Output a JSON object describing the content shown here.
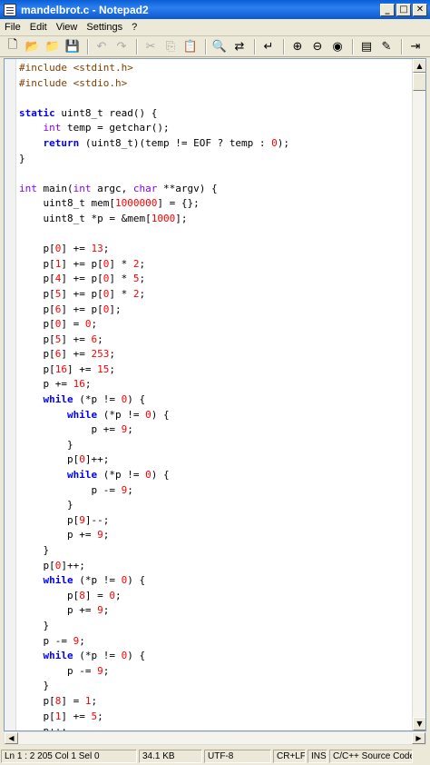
{
  "window": {
    "title": "mandelbrot.c - Notepad2"
  },
  "menu": [
    "File",
    "Edit",
    "View",
    "Settings",
    "?"
  ],
  "toolbar": [
    {
      "icon": "new-file-icon",
      "glyph": "🗋",
      "enabled": true
    },
    {
      "icon": "open-folder-icon",
      "glyph": "📂",
      "enabled": true
    },
    {
      "icon": "browse-icon",
      "glyph": "📁",
      "enabled": true
    },
    {
      "icon": "save-icon",
      "glyph": "💾",
      "enabled": true
    },
    {
      "sep": true
    },
    {
      "icon": "undo-icon",
      "glyph": "↶",
      "enabled": false
    },
    {
      "icon": "redo-icon",
      "glyph": "↷",
      "enabled": false
    },
    {
      "sep": true
    },
    {
      "icon": "cut-icon",
      "glyph": "✂",
      "enabled": false
    },
    {
      "icon": "copy-icon",
      "glyph": "⎘",
      "enabled": false
    },
    {
      "icon": "paste-icon",
      "glyph": "📋",
      "enabled": false
    },
    {
      "sep": true
    },
    {
      "icon": "find-icon",
      "glyph": "🔍",
      "enabled": true
    },
    {
      "icon": "replace-icon",
      "glyph": "⇄",
      "enabled": true
    },
    {
      "sep": true
    },
    {
      "icon": "word-wrap-icon",
      "glyph": "↵",
      "enabled": true
    },
    {
      "sep": true
    },
    {
      "icon": "zoom-in-icon",
      "glyph": "⊕",
      "enabled": true
    },
    {
      "icon": "zoom-out-icon",
      "glyph": "⊖",
      "enabled": true
    },
    {
      "icon": "scheme-icon",
      "glyph": "◉",
      "enabled": true
    },
    {
      "sep": true
    },
    {
      "icon": "settings-icon",
      "glyph": "▤",
      "enabled": true
    },
    {
      "icon": "customize-icon",
      "glyph": "✎",
      "enabled": true
    },
    {
      "sep": true
    },
    {
      "icon": "exit-icon",
      "glyph": "⇥",
      "enabled": true
    }
  ],
  "code_lines": [
    [
      [
        "pp",
        "#include "
      ],
      [
        "inc",
        "<stdint.h>"
      ]
    ],
    [
      [
        "pp",
        "#include "
      ],
      [
        "inc",
        "<stdio.h>"
      ]
    ],
    [],
    [
      [
        "kw",
        "static "
      ],
      [
        "t",
        "uint8_t read() {"
      ]
    ],
    [
      [
        "t",
        "    "
      ],
      [
        "ty",
        "int"
      ],
      [
        "t",
        " temp = getchar();"
      ]
    ],
    [
      [
        "t",
        "    "
      ],
      [
        "kw",
        "return"
      ],
      [
        "t",
        " (uint8_t)(temp != EOF ? temp : "
      ],
      [
        "num",
        "0"
      ],
      [
        "t",
        ");"
      ]
    ],
    [
      [
        "t",
        "}"
      ]
    ],
    [],
    [
      [
        "ty",
        "int"
      ],
      [
        "t",
        " main("
      ],
      [
        "ty",
        "int"
      ],
      [
        "t",
        " argc, "
      ],
      [
        "ty",
        "char"
      ],
      [
        "t",
        " **argv) {"
      ]
    ],
    [
      [
        "t",
        "    uint8_t mem["
      ],
      [
        "num",
        "1000000"
      ],
      [
        "t",
        "] = {};"
      ]
    ],
    [
      [
        "t",
        "    uint8_t *p = &mem["
      ],
      [
        "num",
        "1000"
      ],
      [
        "t",
        "];"
      ]
    ],
    [],
    [
      [
        "t",
        "    p["
      ],
      [
        "num",
        "0"
      ],
      [
        "t",
        "] += "
      ],
      [
        "num",
        "13"
      ],
      [
        "t",
        ";"
      ]
    ],
    [
      [
        "t",
        "    p["
      ],
      [
        "num",
        "1"
      ],
      [
        "t",
        "] += p["
      ],
      [
        "num",
        "0"
      ],
      [
        "t",
        "] * "
      ],
      [
        "num",
        "2"
      ],
      [
        "t",
        ";"
      ]
    ],
    [
      [
        "t",
        "    p["
      ],
      [
        "num",
        "4"
      ],
      [
        "t",
        "] += p["
      ],
      [
        "num",
        "0"
      ],
      [
        "t",
        "] * "
      ],
      [
        "num",
        "5"
      ],
      [
        "t",
        ";"
      ]
    ],
    [
      [
        "t",
        "    p["
      ],
      [
        "num",
        "5"
      ],
      [
        "t",
        "] += p["
      ],
      [
        "num",
        "0"
      ],
      [
        "t",
        "] * "
      ],
      [
        "num",
        "2"
      ],
      [
        "t",
        ";"
      ]
    ],
    [
      [
        "t",
        "    p["
      ],
      [
        "num",
        "6"
      ],
      [
        "t",
        "] += p["
      ],
      [
        "num",
        "0"
      ],
      [
        "t",
        "];"
      ]
    ],
    [
      [
        "t",
        "    p["
      ],
      [
        "num",
        "0"
      ],
      [
        "t",
        "] = "
      ],
      [
        "num",
        "0"
      ],
      [
        "t",
        ";"
      ]
    ],
    [
      [
        "t",
        "    p["
      ],
      [
        "num",
        "5"
      ],
      [
        "t",
        "] += "
      ],
      [
        "num",
        "6"
      ],
      [
        "t",
        ";"
      ]
    ],
    [
      [
        "t",
        "    p["
      ],
      [
        "num",
        "6"
      ],
      [
        "t",
        "] += "
      ],
      [
        "num",
        "253"
      ],
      [
        "t",
        ";"
      ]
    ],
    [
      [
        "t",
        "    p["
      ],
      [
        "num",
        "16"
      ],
      [
        "t",
        "] += "
      ],
      [
        "num",
        "15"
      ],
      [
        "t",
        ";"
      ]
    ],
    [
      [
        "t",
        "    p += "
      ],
      [
        "num",
        "16"
      ],
      [
        "t",
        ";"
      ]
    ],
    [
      [
        "t",
        "    "
      ],
      [
        "kw",
        "while"
      ],
      [
        "t",
        " (*p != "
      ],
      [
        "num",
        "0"
      ],
      [
        "t",
        ") {"
      ]
    ],
    [
      [
        "t",
        "        "
      ],
      [
        "kw",
        "while"
      ],
      [
        "t",
        " (*p != "
      ],
      [
        "num",
        "0"
      ],
      [
        "t",
        ") {"
      ]
    ],
    [
      [
        "t",
        "            p += "
      ],
      [
        "num",
        "9"
      ],
      [
        "t",
        ";"
      ]
    ],
    [
      [
        "t",
        "        }"
      ]
    ],
    [
      [
        "t",
        "        p["
      ],
      [
        "num",
        "0"
      ],
      [
        "t",
        "]++;"
      ]
    ],
    [
      [
        "t",
        "        "
      ],
      [
        "kw",
        "while"
      ],
      [
        "t",
        " (*p != "
      ],
      [
        "num",
        "0"
      ],
      [
        "t",
        ") {"
      ]
    ],
    [
      [
        "t",
        "            p -= "
      ],
      [
        "num",
        "9"
      ],
      [
        "t",
        ";"
      ]
    ],
    [
      [
        "t",
        "        }"
      ]
    ],
    [
      [
        "t",
        "        p["
      ],
      [
        "num",
        "9"
      ],
      [
        "t",
        "]--;"
      ]
    ],
    [
      [
        "t",
        "        p += "
      ],
      [
        "num",
        "9"
      ],
      [
        "t",
        ";"
      ]
    ],
    [
      [
        "t",
        "    }"
      ]
    ],
    [
      [
        "t",
        "    p["
      ],
      [
        "num",
        "0"
      ],
      [
        "t",
        "]++;"
      ]
    ],
    [
      [
        "t",
        "    "
      ],
      [
        "kw",
        "while"
      ],
      [
        "t",
        " (*p != "
      ],
      [
        "num",
        "0"
      ],
      [
        "t",
        ") {"
      ]
    ],
    [
      [
        "t",
        "        p["
      ],
      [
        "num",
        "8"
      ],
      [
        "t",
        "] = "
      ],
      [
        "num",
        "0"
      ],
      [
        "t",
        ";"
      ]
    ],
    [
      [
        "t",
        "        p += "
      ],
      [
        "num",
        "9"
      ],
      [
        "t",
        ";"
      ]
    ],
    [
      [
        "t",
        "    }"
      ]
    ],
    [
      [
        "t",
        "    p -= "
      ],
      [
        "num",
        "9"
      ],
      [
        "t",
        ";"
      ]
    ],
    [
      [
        "t",
        "    "
      ],
      [
        "kw",
        "while"
      ],
      [
        "t",
        " (*p != "
      ],
      [
        "num",
        "0"
      ],
      [
        "t",
        ") {"
      ]
    ],
    [
      [
        "t",
        "        p -= "
      ],
      [
        "num",
        "9"
      ],
      [
        "t",
        ";"
      ]
    ],
    [
      [
        "t",
        "    }"
      ]
    ],
    [
      [
        "t",
        "    p["
      ],
      [
        "num",
        "8"
      ],
      [
        "t",
        "] = "
      ],
      [
        "num",
        "1"
      ],
      [
        "t",
        ";"
      ]
    ],
    [
      [
        "t",
        "    p["
      ],
      [
        "num",
        "1"
      ],
      [
        "t",
        "] += "
      ],
      [
        "num",
        "5"
      ],
      [
        "t",
        ";"
      ]
    ],
    [
      [
        "t",
        "    p++;"
      ]
    ]
  ],
  "status": {
    "position": "Ln 1 : 2 205   Col 1   Sel 0",
    "size": "34.1 KB",
    "encoding": "UTF-8",
    "eol": "CR+LF",
    "ovr": "INS",
    "lexer": "C/C++ Source Code"
  }
}
